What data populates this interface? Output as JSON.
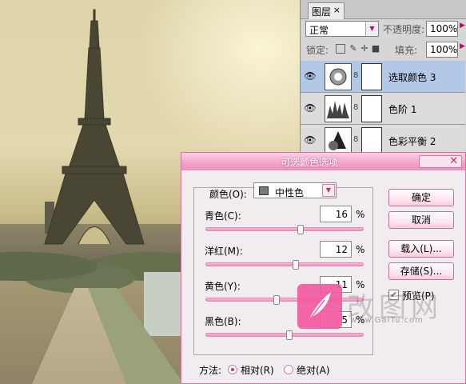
{
  "layers_panel": {
    "tab_label": "图层",
    "blend_mode": "正常",
    "opacity_label": "不透明度:",
    "opacity_value": "100%",
    "lock_label": "锁定:",
    "fill_label": "填充:",
    "fill_value": "100%",
    "layers": [
      {
        "name": "选取颜色 3",
        "selected": true,
        "icon": "selective-color-adjustment-icon"
      },
      {
        "name": "色阶 1",
        "selected": false,
        "icon": "levels-adjustment-icon"
      },
      {
        "name": "色彩平衡 2",
        "selected": false,
        "icon": "color-balance-adjustment-icon"
      }
    ]
  },
  "dialog": {
    "title": "可选颜色选项",
    "colors_label": "颜色(O):",
    "colors_value": "中性色",
    "sliders": [
      {
        "label": "青色(C):",
        "value": "16",
        "fraction": 0.6
      },
      {
        "label": "洋红(M):",
        "value": "12",
        "fraction": 0.57
      },
      {
        "label": "黄色(Y):",
        "value": "-11",
        "fraction": 0.45
      },
      {
        "label": "黑色(B):",
        "value": "5",
        "fraction": 0.53
      }
    ],
    "percent": "%",
    "buttons": {
      "ok": "确定",
      "cancel": "取消",
      "load": "载入(L)...",
      "save": "存储(S)..."
    },
    "preview_label": "预览(P)",
    "preview_checked": true,
    "method_label": "方法:",
    "method_relative": "相对(R)",
    "method_absolute": "绝对(A)",
    "method_selected": "relative"
  },
  "watermark": {
    "text_cn": "改图网",
    "url": "www.GaiTu.com"
  }
}
